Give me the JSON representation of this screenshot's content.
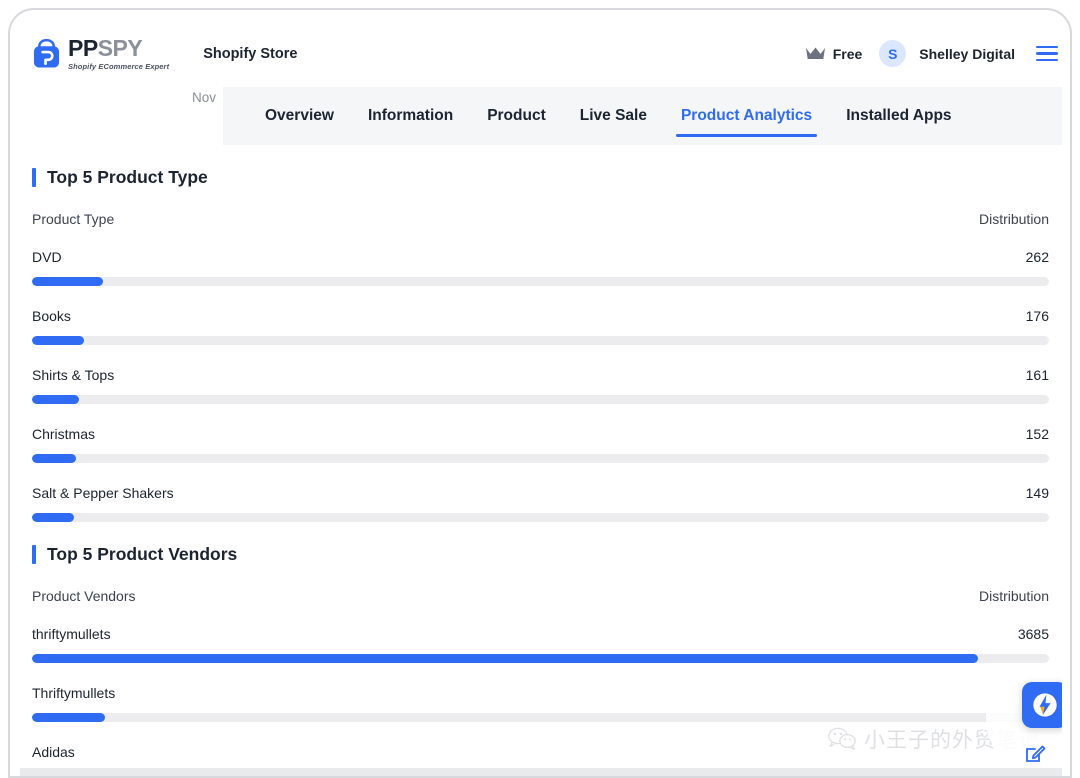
{
  "header": {
    "logo": {
      "icon": "shopping-bag-icon",
      "word_primary": "PP",
      "word_secondary": "SPY",
      "tagline": "Shopify ECommerce Expert"
    },
    "store_name": "Shopify Store",
    "plan": {
      "icon": "crown-icon",
      "label": "Free"
    },
    "avatar_initial": "S",
    "user_name": "Shelley Digital",
    "menu_icon": "hamburger-menu-icon"
  },
  "chart_stub": {
    "month_label": "Nov"
  },
  "tabs": [
    {
      "label": "Overview",
      "active": false
    },
    {
      "label": "Information",
      "active": false
    },
    {
      "label": "Product",
      "active": false
    },
    {
      "label": "Live Sale",
      "active": false
    },
    {
      "label": "Product Analytics",
      "active": true
    },
    {
      "label": "Installed Apps",
      "active": false
    }
  ],
  "sections": [
    {
      "title": "Top 5 Product Type",
      "col_left": "Product Type",
      "col_right": "Distribution"
    },
    {
      "title": "Top 5 Product Vendors",
      "col_left": "Product Vendors",
      "col_right": "Distribution"
    }
  ],
  "watermark": {
    "text": "小王子的外贸笔记",
    "icon": "wechat-icon"
  },
  "floating": {
    "chat_icon": "chat-widget-icon",
    "edit_icon": "edit-pencil-icon"
  },
  "colors": {
    "accent": "#2f6bf3",
    "track": "#ececee",
    "text": "#1b2430",
    "muted": "#8b9099",
    "band": "#f5f6f8"
  },
  "chart_data": [
    {
      "type": "bar",
      "title": "Top 5 Product Type",
      "orientation": "horizontal",
      "xlabel": "Product Type",
      "ylabel": "Distribution",
      "categories": [
        "DVD",
        "Books",
        "Shirts & Tops",
        "Christmas",
        "Salt & Pepper Shakers"
      ],
      "values": [
        262,
        176,
        161,
        152,
        149
      ],
      "bar_percents": [
        7.0,
        5.1,
        4.6,
        4.3,
        4.1
      ],
      "grid": false,
      "legend": "none"
    },
    {
      "type": "bar",
      "title": "Top 5 Product Vendors",
      "orientation": "horizontal",
      "xlabel": "Product Vendors",
      "ylabel": "Distribution",
      "categories": [
        "thriftymullets",
        "Thriftymullets",
        "Adidas"
      ],
      "values": [
        3685,
        275,
        null
      ],
      "bar_percents": [
        93.0,
        7.2,
        0.6
      ],
      "grid": false,
      "legend": "none",
      "note": "third row partially cut off at viewport bottom"
    }
  ]
}
